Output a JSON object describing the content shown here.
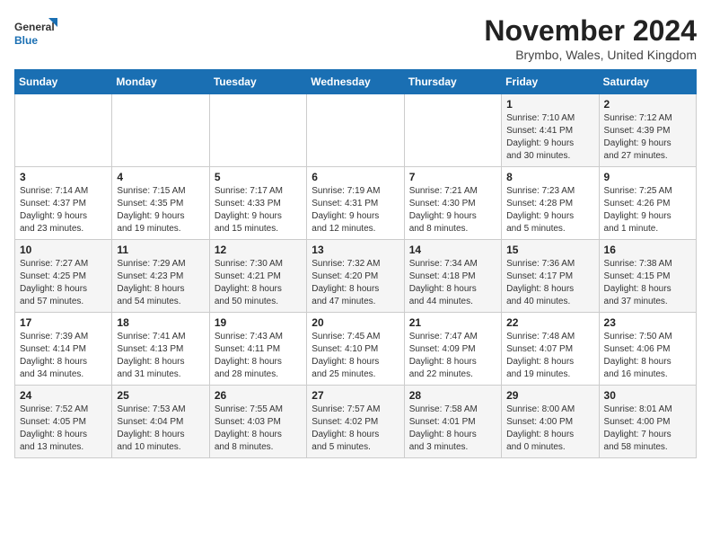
{
  "logo": {
    "text_general": "General",
    "text_blue": "Blue"
  },
  "header": {
    "month": "November 2024",
    "location": "Brymbo, Wales, United Kingdom"
  },
  "weekdays": [
    "Sunday",
    "Monday",
    "Tuesday",
    "Wednesday",
    "Thursday",
    "Friday",
    "Saturday"
  ],
  "weeks": [
    [
      {
        "day": "",
        "info": ""
      },
      {
        "day": "",
        "info": ""
      },
      {
        "day": "",
        "info": ""
      },
      {
        "day": "",
        "info": ""
      },
      {
        "day": "",
        "info": ""
      },
      {
        "day": "1",
        "info": "Sunrise: 7:10 AM\nSunset: 4:41 PM\nDaylight: 9 hours\nand 30 minutes."
      },
      {
        "day": "2",
        "info": "Sunrise: 7:12 AM\nSunset: 4:39 PM\nDaylight: 9 hours\nand 27 minutes."
      }
    ],
    [
      {
        "day": "3",
        "info": "Sunrise: 7:14 AM\nSunset: 4:37 PM\nDaylight: 9 hours\nand 23 minutes."
      },
      {
        "day": "4",
        "info": "Sunrise: 7:15 AM\nSunset: 4:35 PM\nDaylight: 9 hours\nand 19 minutes."
      },
      {
        "day": "5",
        "info": "Sunrise: 7:17 AM\nSunset: 4:33 PM\nDaylight: 9 hours\nand 15 minutes."
      },
      {
        "day": "6",
        "info": "Sunrise: 7:19 AM\nSunset: 4:31 PM\nDaylight: 9 hours\nand 12 minutes."
      },
      {
        "day": "7",
        "info": "Sunrise: 7:21 AM\nSunset: 4:30 PM\nDaylight: 9 hours\nand 8 minutes."
      },
      {
        "day": "8",
        "info": "Sunrise: 7:23 AM\nSunset: 4:28 PM\nDaylight: 9 hours\nand 5 minutes."
      },
      {
        "day": "9",
        "info": "Sunrise: 7:25 AM\nSunset: 4:26 PM\nDaylight: 9 hours\nand 1 minute."
      }
    ],
    [
      {
        "day": "10",
        "info": "Sunrise: 7:27 AM\nSunset: 4:25 PM\nDaylight: 8 hours\nand 57 minutes."
      },
      {
        "day": "11",
        "info": "Sunrise: 7:29 AM\nSunset: 4:23 PM\nDaylight: 8 hours\nand 54 minutes."
      },
      {
        "day": "12",
        "info": "Sunrise: 7:30 AM\nSunset: 4:21 PM\nDaylight: 8 hours\nand 50 minutes."
      },
      {
        "day": "13",
        "info": "Sunrise: 7:32 AM\nSunset: 4:20 PM\nDaylight: 8 hours\nand 47 minutes."
      },
      {
        "day": "14",
        "info": "Sunrise: 7:34 AM\nSunset: 4:18 PM\nDaylight: 8 hours\nand 44 minutes."
      },
      {
        "day": "15",
        "info": "Sunrise: 7:36 AM\nSunset: 4:17 PM\nDaylight: 8 hours\nand 40 minutes."
      },
      {
        "day": "16",
        "info": "Sunrise: 7:38 AM\nSunset: 4:15 PM\nDaylight: 8 hours\nand 37 minutes."
      }
    ],
    [
      {
        "day": "17",
        "info": "Sunrise: 7:39 AM\nSunset: 4:14 PM\nDaylight: 8 hours\nand 34 minutes."
      },
      {
        "day": "18",
        "info": "Sunrise: 7:41 AM\nSunset: 4:13 PM\nDaylight: 8 hours\nand 31 minutes."
      },
      {
        "day": "19",
        "info": "Sunrise: 7:43 AM\nSunset: 4:11 PM\nDaylight: 8 hours\nand 28 minutes."
      },
      {
        "day": "20",
        "info": "Sunrise: 7:45 AM\nSunset: 4:10 PM\nDaylight: 8 hours\nand 25 minutes."
      },
      {
        "day": "21",
        "info": "Sunrise: 7:47 AM\nSunset: 4:09 PM\nDaylight: 8 hours\nand 22 minutes."
      },
      {
        "day": "22",
        "info": "Sunrise: 7:48 AM\nSunset: 4:07 PM\nDaylight: 8 hours\nand 19 minutes."
      },
      {
        "day": "23",
        "info": "Sunrise: 7:50 AM\nSunset: 4:06 PM\nDaylight: 8 hours\nand 16 minutes."
      }
    ],
    [
      {
        "day": "24",
        "info": "Sunrise: 7:52 AM\nSunset: 4:05 PM\nDaylight: 8 hours\nand 13 minutes."
      },
      {
        "day": "25",
        "info": "Sunrise: 7:53 AM\nSunset: 4:04 PM\nDaylight: 8 hours\nand 10 minutes."
      },
      {
        "day": "26",
        "info": "Sunrise: 7:55 AM\nSunset: 4:03 PM\nDaylight: 8 hours\nand 8 minutes."
      },
      {
        "day": "27",
        "info": "Sunrise: 7:57 AM\nSunset: 4:02 PM\nDaylight: 8 hours\nand 5 minutes."
      },
      {
        "day": "28",
        "info": "Sunrise: 7:58 AM\nSunset: 4:01 PM\nDaylight: 8 hours\nand 3 minutes."
      },
      {
        "day": "29",
        "info": "Sunrise: 8:00 AM\nSunset: 4:00 PM\nDaylight: 8 hours\nand 0 minutes."
      },
      {
        "day": "30",
        "info": "Sunrise: 8:01 AM\nSunset: 4:00 PM\nDaylight: 7 hours\nand 58 minutes."
      }
    ]
  ]
}
